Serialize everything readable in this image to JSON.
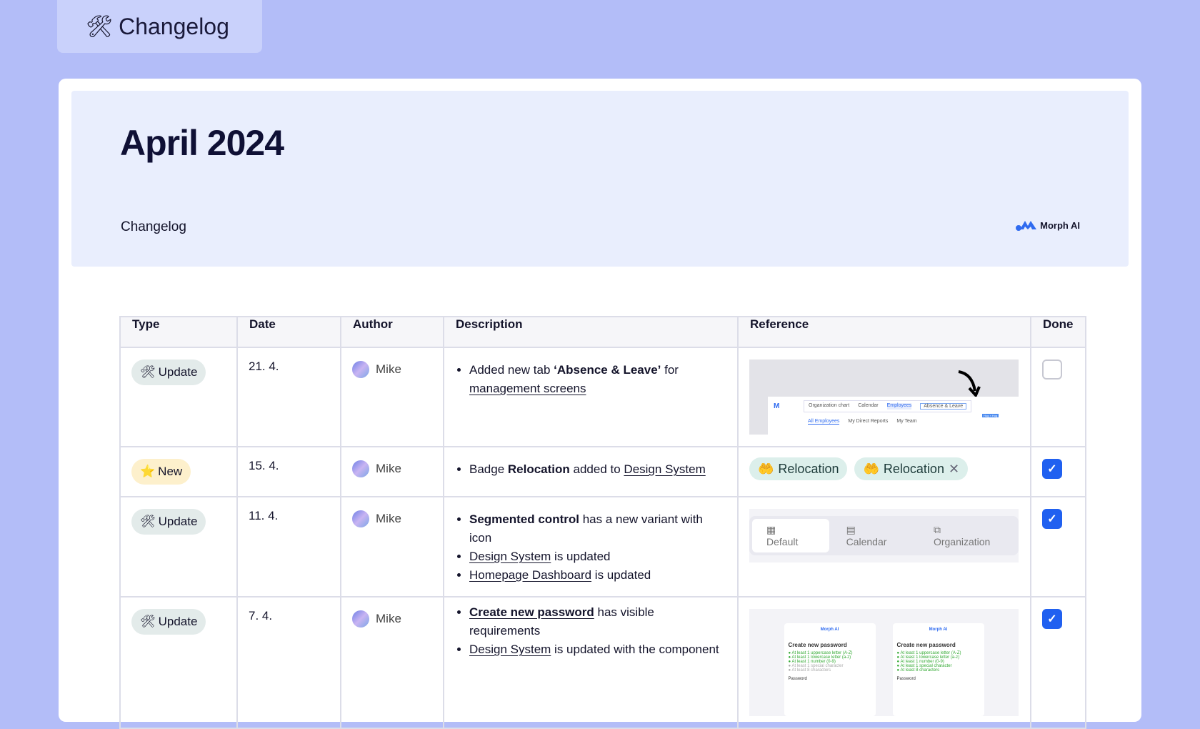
{
  "tab": {
    "icon": "hammer-and-wrench-icon",
    "label": "Changelog"
  },
  "header": {
    "title": "April 2024",
    "subtitle": "Changelog",
    "logo": "Morph AI"
  },
  "table": {
    "columns": [
      "Type",
      "Date",
      "Author",
      "Description",
      "Reference",
      "Done"
    ],
    "rows": [
      {
        "type": "Update",
        "type_icon": "🛠",
        "date": "21. 4.",
        "author": "Mike",
        "desc": {
          "pre": "Added new tab ",
          "bold": "‘Absence & Leave’",
          "mid": " for ",
          "link": "management screens"
        },
        "ref": {
          "tabs": [
            "Organization chart",
            "Calendar",
            "Employees",
            "Absence & Leave"
          ],
          "subtabs": [
            "All Employees",
            "My Direct Reports",
            "My Team"
          ],
          "tag": "Hug × Hug"
        },
        "done": false
      },
      {
        "type": "New",
        "type_icon": "⭐",
        "date": "15. 4.",
        "author": "Mike",
        "desc": {
          "pre": "Badge ",
          "bold": "Relocation",
          "mid": " added to ",
          "link": "Design System"
        },
        "ref": {
          "badge": "Relocation"
        },
        "done": true
      },
      {
        "type": "Update",
        "type_icon": "🛠",
        "date": "11. 4.",
        "author": "Mike",
        "desc": {
          "b1": "Segmented control",
          "t1": " has a new variant with icon",
          "l2": "Design System",
          "t2": " is updated",
          "l3": "Homepage Dashboard",
          "t3": " is updated"
        },
        "ref": {
          "segments": [
            "Default",
            "Calendar",
            "Organization"
          ]
        },
        "done": true
      },
      {
        "type": "Update",
        "type_icon": "🛠",
        "date": "7. 4.",
        "author": "Mike",
        "desc": {
          "l1": "Create new password",
          "t1": " has visible requirements",
          "l2": "Design System",
          "t2": " is updated with the component"
        },
        "ref": {
          "logo": "Morph AI",
          "heading": "Create new password",
          "reqs": [
            "At least 1 uppercase letter (A-Z)",
            "At least 1 lowercase letter (a-z)",
            "At least 1 number (0-9)",
            "At least 1 special character",
            "At least 8 characters"
          ],
          "field": "Password"
        },
        "done": true
      }
    ]
  },
  "colors": {
    "background": "#b3bdf8",
    "banner": "#e9eefd",
    "accent": "#2060f0"
  }
}
